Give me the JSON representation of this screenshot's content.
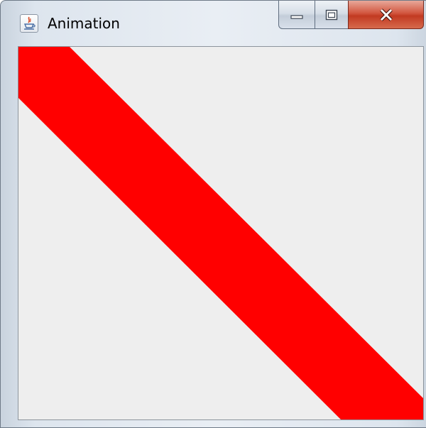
{
  "window": {
    "title": "Animation",
    "icon": "java-cup-icon"
  },
  "caption_buttons": [
    {
      "name": "minimize",
      "icon": "minimize-icon"
    },
    {
      "name": "maximize",
      "icon": "maximize-icon"
    },
    {
      "name": "close",
      "icon": "close-icon"
    }
  ],
  "canvas": {
    "background": "#eeeeee",
    "stripe_color": "#ff0000"
  }
}
